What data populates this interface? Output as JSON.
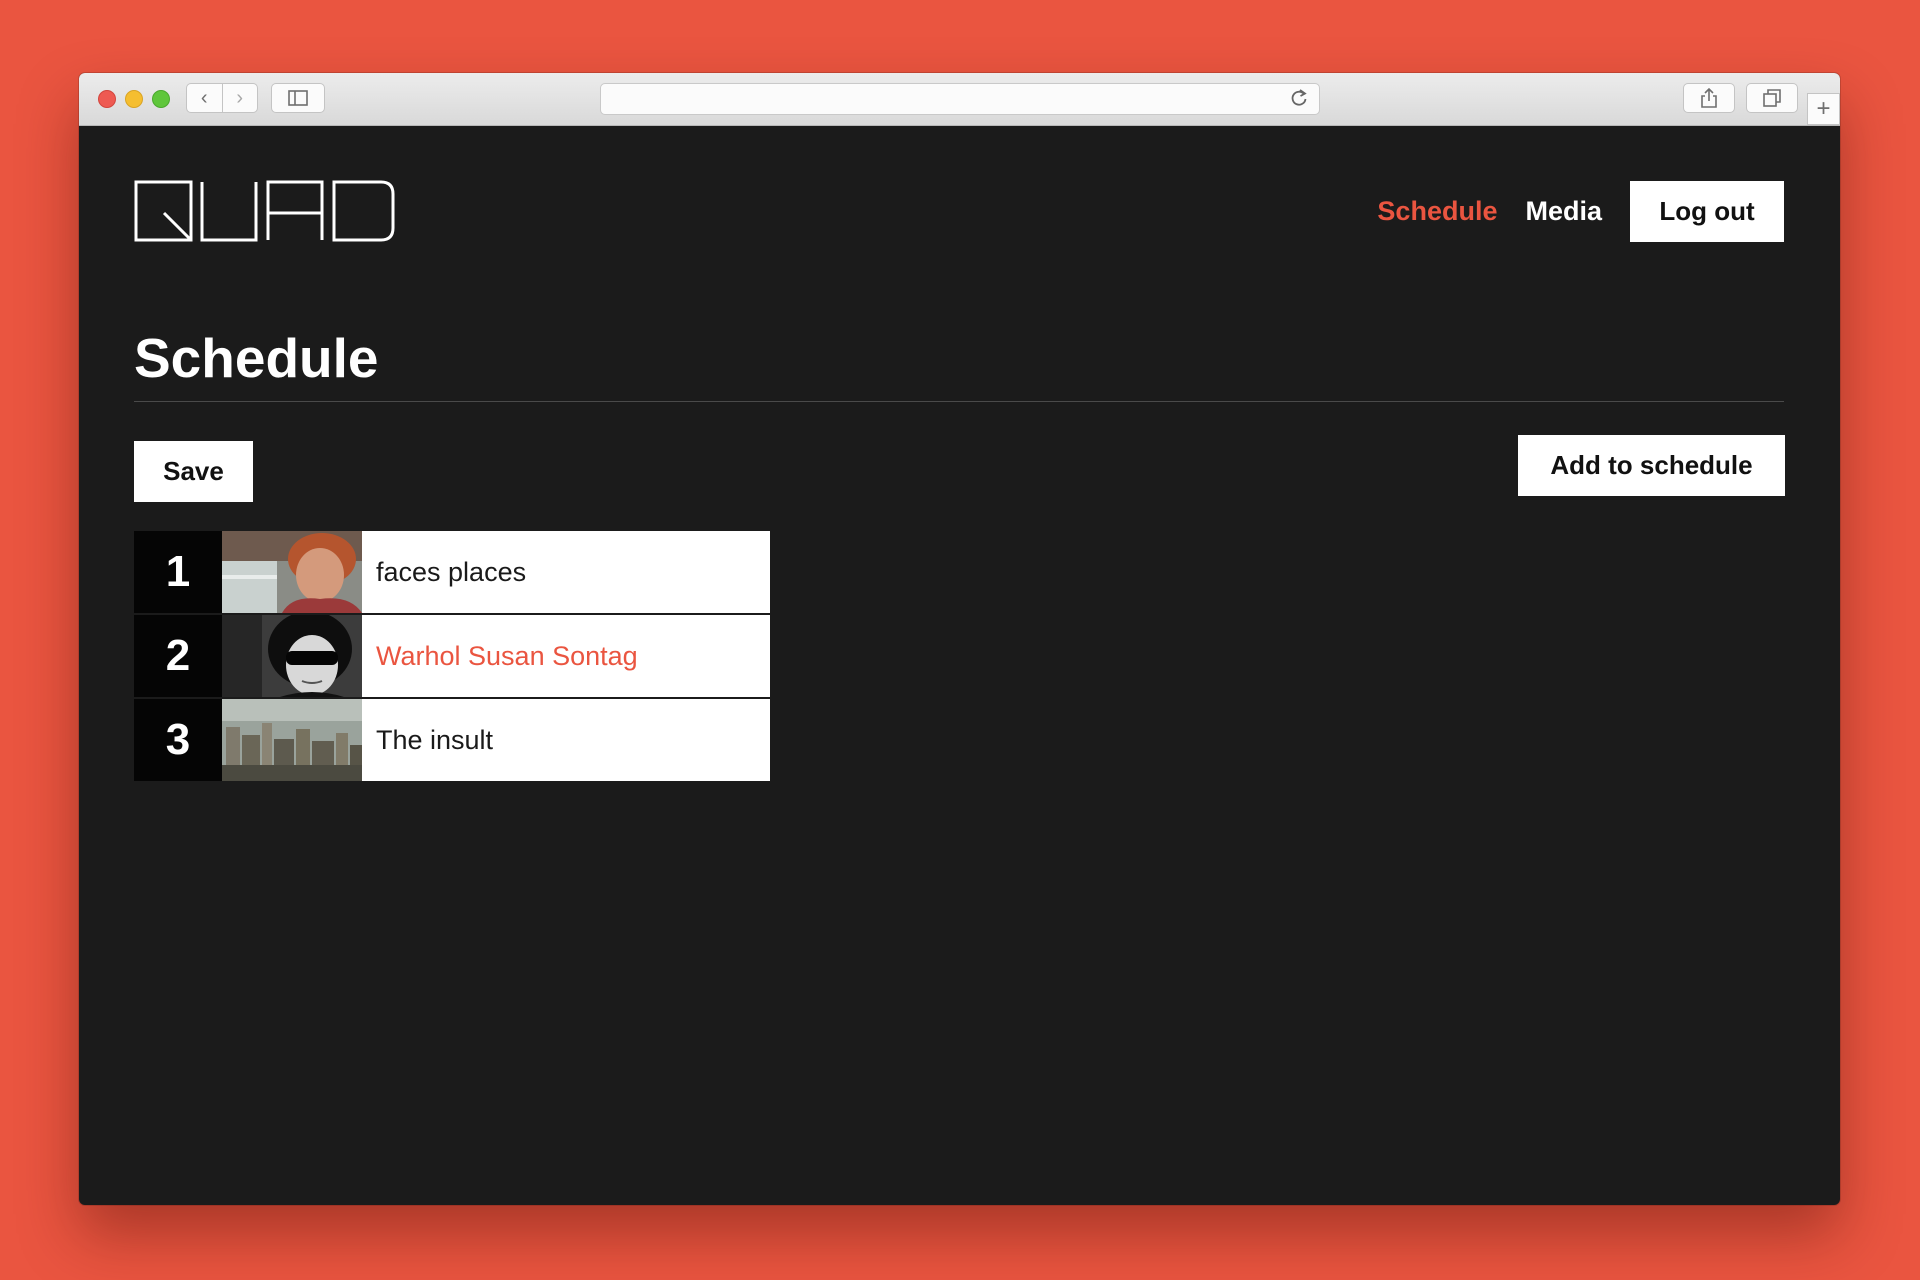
{
  "app": {
    "logo_text": "QUAD"
  },
  "nav": {
    "schedule_label": "Schedule",
    "media_label": "Media",
    "logout_label": "Log out"
  },
  "page": {
    "title": "Schedule",
    "save_label": "Save",
    "add_label": "Add to schedule"
  },
  "schedule": [
    {
      "number": "1",
      "title": "faces places"
    },
    {
      "number": "2",
      "title": "Warhol Susan Sontag"
    },
    {
      "number": "3",
      "title": "The insult"
    }
  ],
  "colors": {
    "accent": "#ea5540",
    "background": "#1b1b1b",
    "button": "#ffffff"
  },
  "icons": [
    "back-icon",
    "forward-icon",
    "sidebar-icon",
    "reload-icon",
    "share-icon",
    "tabs-icon",
    "new-tab-icon"
  ]
}
